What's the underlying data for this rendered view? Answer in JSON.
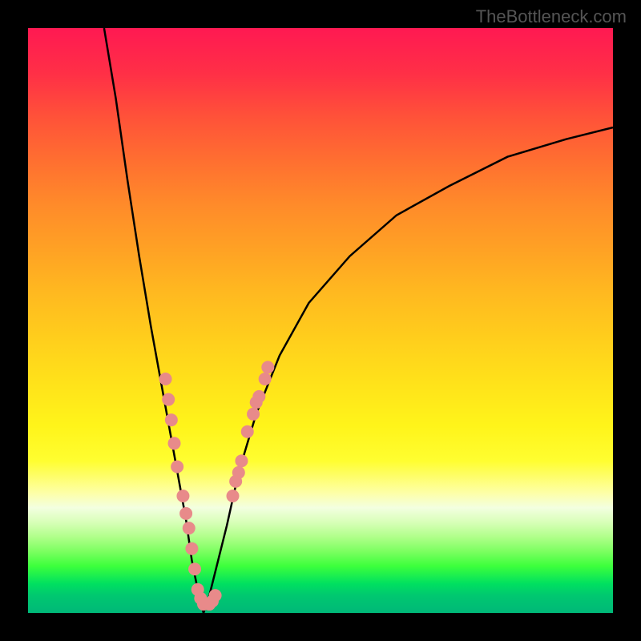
{
  "watermark": "TheBottleneck.com",
  "chart_data": {
    "type": "line",
    "title": "",
    "xlabel": "",
    "ylabel": "",
    "xlim": [
      0,
      100
    ],
    "ylim": [
      0,
      100
    ],
    "curve": {
      "description": "V-shaped bottleneck curve, minimum at approximately x=30",
      "left_branch_x": [
        13,
        15,
        17,
        19,
        21,
        23,
        25,
        27,
        28,
        29,
        30
      ],
      "left_branch_y": [
        100,
        88,
        74,
        61,
        49,
        38,
        27,
        16,
        9,
        4,
        0
      ],
      "right_branch_x": [
        30,
        31,
        32,
        34,
        36,
        39,
        43,
        48,
        55,
        63,
        72,
        82,
        92,
        100
      ],
      "right_branch_y": [
        0,
        3,
        7,
        15,
        24,
        34,
        44,
        53,
        61,
        68,
        73,
        78,
        81,
        83
      ]
    },
    "scatter_points": {
      "description": "Pink/salmon data points clustered near bottom of V curve",
      "points": [
        {
          "x": 23.5,
          "y": 40
        },
        {
          "x": 24,
          "y": 36.5
        },
        {
          "x": 24.5,
          "y": 33
        },
        {
          "x": 25,
          "y": 29
        },
        {
          "x": 25.5,
          "y": 25
        },
        {
          "x": 26.5,
          "y": 20
        },
        {
          "x": 27,
          "y": 17
        },
        {
          "x": 27.5,
          "y": 14.5
        },
        {
          "x": 28,
          "y": 11
        },
        {
          "x": 28.5,
          "y": 7.5
        },
        {
          "x": 29,
          "y": 4
        },
        {
          "x": 29.5,
          "y": 2.5
        },
        {
          "x": 30,
          "y": 1.5
        },
        {
          "x": 31,
          "y": 1.5
        },
        {
          "x": 31.5,
          "y": 2
        },
        {
          "x": 32,
          "y": 3
        },
        {
          "x": 35,
          "y": 20
        },
        {
          "x": 35.5,
          "y": 22.5
        },
        {
          "x": 36,
          "y": 24
        },
        {
          "x": 36.5,
          "y": 26
        },
        {
          "x": 37.5,
          "y": 31
        },
        {
          "x": 38.5,
          "y": 34
        },
        {
          "x": 39,
          "y": 36
        },
        {
          "x": 39.5,
          "y": 37
        },
        {
          "x": 40.5,
          "y": 40
        },
        {
          "x": 41,
          "y": 42
        }
      ],
      "color": "#e88a8a",
      "radius": 8
    }
  }
}
